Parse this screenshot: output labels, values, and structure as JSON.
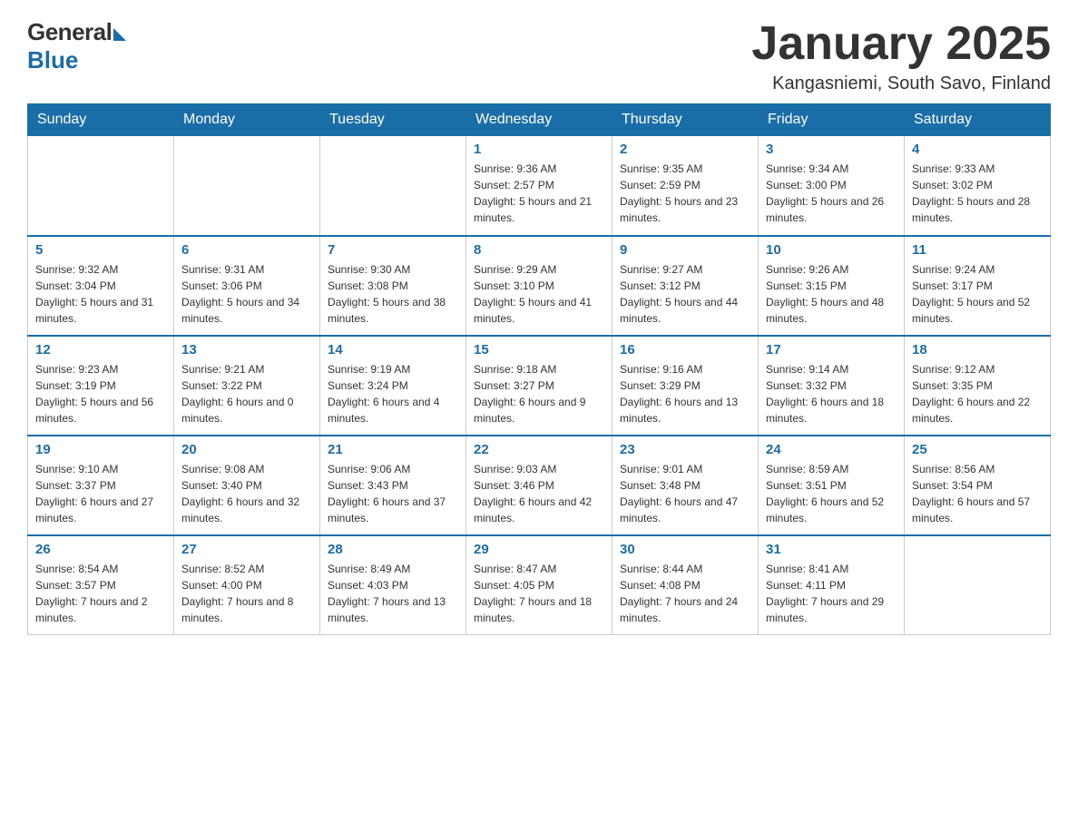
{
  "header": {
    "logo_general": "General",
    "logo_blue": "Blue",
    "title": "January 2025",
    "location": "Kangasniemi, South Savo, Finland"
  },
  "weekdays": [
    "Sunday",
    "Monday",
    "Tuesday",
    "Wednesday",
    "Thursday",
    "Friday",
    "Saturday"
  ],
  "weeks": [
    [
      {
        "day": "",
        "info": ""
      },
      {
        "day": "",
        "info": ""
      },
      {
        "day": "",
        "info": ""
      },
      {
        "day": "1",
        "info": "Sunrise: 9:36 AM\nSunset: 2:57 PM\nDaylight: 5 hours and 21 minutes."
      },
      {
        "day": "2",
        "info": "Sunrise: 9:35 AM\nSunset: 2:59 PM\nDaylight: 5 hours and 23 minutes."
      },
      {
        "day": "3",
        "info": "Sunrise: 9:34 AM\nSunset: 3:00 PM\nDaylight: 5 hours and 26 minutes."
      },
      {
        "day": "4",
        "info": "Sunrise: 9:33 AM\nSunset: 3:02 PM\nDaylight: 5 hours and 28 minutes."
      }
    ],
    [
      {
        "day": "5",
        "info": "Sunrise: 9:32 AM\nSunset: 3:04 PM\nDaylight: 5 hours and 31 minutes."
      },
      {
        "day": "6",
        "info": "Sunrise: 9:31 AM\nSunset: 3:06 PM\nDaylight: 5 hours and 34 minutes."
      },
      {
        "day": "7",
        "info": "Sunrise: 9:30 AM\nSunset: 3:08 PM\nDaylight: 5 hours and 38 minutes."
      },
      {
        "day": "8",
        "info": "Sunrise: 9:29 AM\nSunset: 3:10 PM\nDaylight: 5 hours and 41 minutes."
      },
      {
        "day": "9",
        "info": "Sunrise: 9:27 AM\nSunset: 3:12 PM\nDaylight: 5 hours and 44 minutes."
      },
      {
        "day": "10",
        "info": "Sunrise: 9:26 AM\nSunset: 3:15 PM\nDaylight: 5 hours and 48 minutes."
      },
      {
        "day": "11",
        "info": "Sunrise: 9:24 AM\nSunset: 3:17 PM\nDaylight: 5 hours and 52 minutes."
      }
    ],
    [
      {
        "day": "12",
        "info": "Sunrise: 9:23 AM\nSunset: 3:19 PM\nDaylight: 5 hours and 56 minutes."
      },
      {
        "day": "13",
        "info": "Sunrise: 9:21 AM\nSunset: 3:22 PM\nDaylight: 6 hours and 0 minutes."
      },
      {
        "day": "14",
        "info": "Sunrise: 9:19 AM\nSunset: 3:24 PM\nDaylight: 6 hours and 4 minutes."
      },
      {
        "day": "15",
        "info": "Sunrise: 9:18 AM\nSunset: 3:27 PM\nDaylight: 6 hours and 9 minutes."
      },
      {
        "day": "16",
        "info": "Sunrise: 9:16 AM\nSunset: 3:29 PM\nDaylight: 6 hours and 13 minutes."
      },
      {
        "day": "17",
        "info": "Sunrise: 9:14 AM\nSunset: 3:32 PM\nDaylight: 6 hours and 18 minutes."
      },
      {
        "day": "18",
        "info": "Sunrise: 9:12 AM\nSunset: 3:35 PM\nDaylight: 6 hours and 22 minutes."
      }
    ],
    [
      {
        "day": "19",
        "info": "Sunrise: 9:10 AM\nSunset: 3:37 PM\nDaylight: 6 hours and 27 minutes."
      },
      {
        "day": "20",
        "info": "Sunrise: 9:08 AM\nSunset: 3:40 PM\nDaylight: 6 hours and 32 minutes."
      },
      {
        "day": "21",
        "info": "Sunrise: 9:06 AM\nSunset: 3:43 PM\nDaylight: 6 hours and 37 minutes."
      },
      {
        "day": "22",
        "info": "Sunrise: 9:03 AM\nSunset: 3:46 PM\nDaylight: 6 hours and 42 minutes."
      },
      {
        "day": "23",
        "info": "Sunrise: 9:01 AM\nSunset: 3:48 PM\nDaylight: 6 hours and 47 minutes."
      },
      {
        "day": "24",
        "info": "Sunrise: 8:59 AM\nSunset: 3:51 PM\nDaylight: 6 hours and 52 minutes."
      },
      {
        "day": "25",
        "info": "Sunrise: 8:56 AM\nSunset: 3:54 PM\nDaylight: 6 hours and 57 minutes."
      }
    ],
    [
      {
        "day": "26",
        "info": "Sunrise: 8:54 AM\nSunset: 3:57 PM\nDaylight: 7 hours and 2 minutes."
      },
      {
        "day": "27",
        "info": "Sunrise: 8:52 AM\nSunset: 4:00 PM\nDaylight: 7 hours and 8 minutes."
      },
      {
        "day": "28",
        "info": "Sunrise: 8:49 AM\nSunset: 4:03 PM\nDaylight: 7 hours and 13 minutes."
      },
      {
        "day": "29",
        "info": "Sunrise: 8:47 AM\nSunset: 4:05 PM\nDaylight: 7 hours and 18 minutes."
      },
      {
        "day": "30",
        "info": "Sunrise: 8:44 AM\nSunset: 4:08 PM\nDaylight: 7 hours and 24 minutes."
      },
      {
        "day": "31",
        "info": "Sunrise: 8:41 AM\nSunset: 4:11 PM\nDaylight: 7 hours and 29 minutes."
      },
      {
        "day": "",
        "info": ""
      }
    ]
  ]
}
